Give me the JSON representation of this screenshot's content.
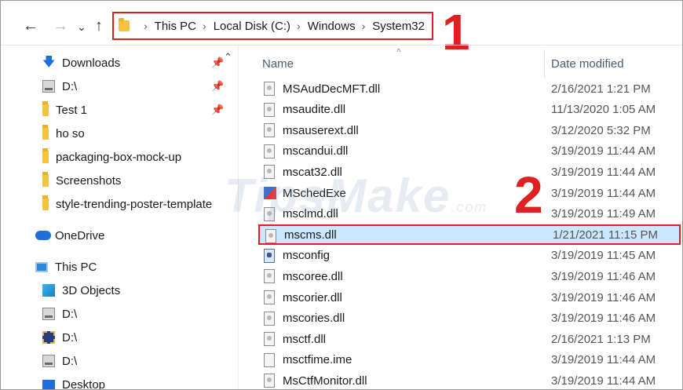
{
  "navigation": {
    "back": "←",
    "forward": "→",
    "recent": "⌄",
    "up": "↑"
  },
  "breadcrumb": [
    "This PC",
    "Local Disk (C:)",
    "Windows",
    "System32"
  ],
  "breadcrumb_separator": "›",
  "annotations": {
    "one": "1",
    "two": "2"
  },
  "watermark": {
    "main": "TipsMake",
    "suffix": ".com"
  },
  "nav_pane": {
    "scroll_up": "⌃",
    "pin_glyph": "📌",
    "quick_access": [
      {
        "label": "Downloads",
        "icon": "download-icon",
        "pinned": true
      },
      {
        "label": "D:\\",
        "icon": "drive-icon",
        "pinned": true
      },
      {
        "label": "Test 1",
        "icon": "folder-icon",
        "pinned": true
      },
      {
        "label": "ho so",
        "icon": "folder-icon",
        "pinned": false
      },
      {
        "label": "packaging-box-mock-up",
        "icon": "folder-icon",
        "pinned": false
      },
      {
        "label": "Screenshots",
        "icon": "folder-icon",
        "pinned": false
      },
      {
        "label": "style-trending-poster-template",
        "icon": "folder-icon",
        "pinned": false
      }
    ],
    "onedrive": "OneDrive",
    "this_pc": "This PC",
    "this_pc_items": [
      {
        "label": "3D Objects",
        "icon": "cube-icon"
      },
      {
        "label": "D:\\",
        "icon": "drive-icon"
      },
      {
        "label": "D:\\",
        "icon": "film-icon"
      },
      {
        "label": "D:\\",
        "icon": "drive-icon"
      },
      {
        "label": "Desktop",
        "icon": "desktop-icon"
      }
    ]
  },
  "columns": {
    "name": "Name",
    "date": "Date modified",
    "sort_caret": "^"
  },
  "files": [
    {
      "name": "MSAudDecMFT.dll",
      "date": "2/16/2021 1:21 PM",
      "icon": "dll"
    },
    {
      "name": "msaudite.dll",
      "date": "11/13/2020 1:05 AM",
      "icon": "dll"
    },
    {
      "name": "msauserext.dll",
      "date": "3/12/2020 5:32 PM",
      "icon": "dll"
    },
    {
      "name": "mscandui.dll",
      "date": "3/19/2019 11:44 AM",
      "icon": "dll"
    },
    {
      "name": "mscat32.dll",
      "date": "3/19/2019 11:44 AM",
      "icon": "dll"
    },
    {
      "name": "MSchedExe",
      "date": "3/19/2019 11:44 AM",
      "icon": "app"
    },
    {
      "name": "msclmd.dll",
      "date": "3/19/2019 11:49 AM",
      "icon": "dll"
    },
    {
      "name": "mscms.dll",
      "date": "1/21/2021 11:15 PM",
      "icon": "dll",
      "selected": true
    },
    {
      "name": "msconfig",
      "date": "3/19/2019 11:45 AM",
      "icon": "cfg"
    },
    {
      "name": "mscoree.dll",
      "date": "3/19/2019 11:46 AM",
      "icon": "dll"
    },
    {
      "name": "mscorier.dll",
      "date": "3/19/2019 11:46 AM",
      "icon": "dll"
    },
    {
      "name": "mscories.dll",
      "date": "3/19/2019 11:46 AM",
      "icon": "dll"
    },
    {
      "name": "msctf.dll",
      "date": "2/16/2021 1:13 PM",
      "icon": "dll"
    },
    {
      "name": "msctfime.ime",
      "date": "3/19/2019 11:44 AM",
      "icon": "blank"
    },
    {
      "name": "MsCtfMonitor.dll",
      "date": "3/19/2019 11:44 AM",
      "icon": "dll"
    }
  ],
  "colors": {
    "annotation": "#e02020",
    "selection": "#cce8ff",
    "accent": "#1e6fd9"
  }
}
